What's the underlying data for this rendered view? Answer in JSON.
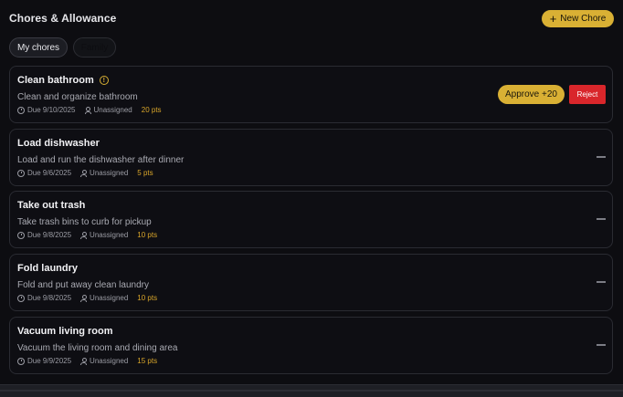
{
  "header": {
    "title": "Chores & Allowance",
    "new_chore_label": "New Chore"
  },
  "tabs": [
    {
      "label": "My chores"
    },
    {
      "label": "Family"
    }
  ],
  "colors": {
    "accent": "#d9b034",
    "reject": "#d9262b",
    "points": "#d9a62a"
  },
  "chores": [
    {
      "title": "Clean bathroom",
      "description": "Clean and organize bathroom",
      "due": "Due 9/10/2025",
      "assignee": "Unassigned",
      "points": "20 pts",
      "status_icon": "alert-circle-icon",
      "approve_label": "Approve +20",
      "reject_label": "Reject"
    },
    {
      "title": "Load dishwasher",
      "description": "Load and run the dishwasher after dinner",
      "due": "Due 9/6/2025",
      "assignee": "Unassigned",
      "points": "5 pts"
    },
    {
      "title": "Take out trash",
      "description": "Take trash bins to curb for pickup",
      "due": "Due 9/8/2025",
      "assignee": "Unassigned",
      "points": "10 pts"
    },
    {
      "title": "Fold laundry",
      "description": "Fold and put away clean laundry",
      "due": "Due 9/8/2025",
      "assignee": "Unassigned",
      "points": "10 pts"
    },
    {
      "title": "Vacuum living room",
      "description": "Vacuum the living room and dining area",
      "due": "Due 9/9/2025",
      "assignee": "Unassigned",
      "points": "15 pts"
    }
  ]
}
